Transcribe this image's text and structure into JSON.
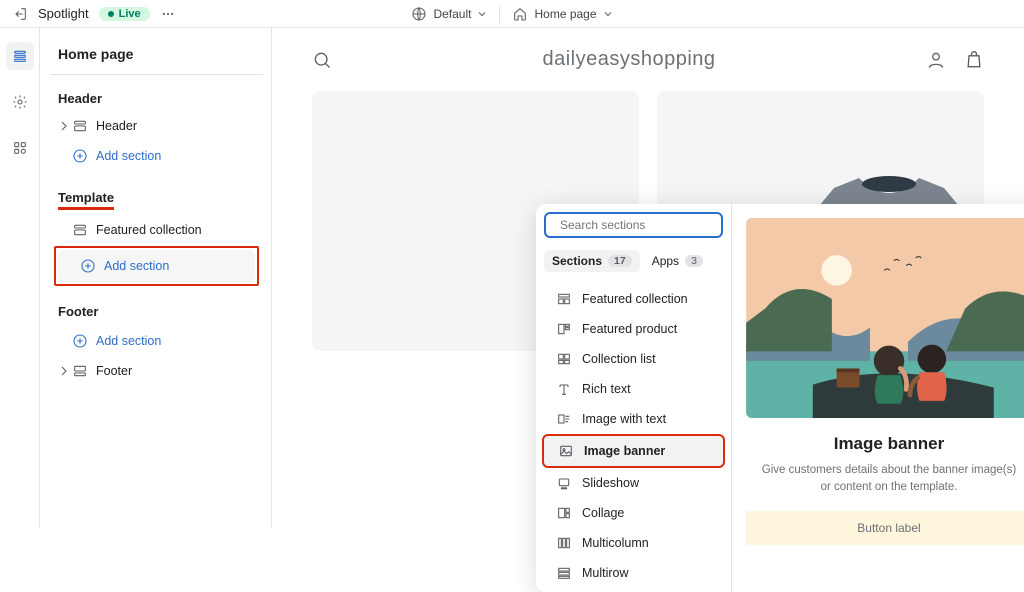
{
  "topbar": {
    "theme_name": "Spotlight",
    "status": "Live",
    "locale": "Default",
    "page_select": "Home page"
  },
  "sidebar": {
    "title": "Home page",
    "header": {
      "label": "Header",
      "item": "Header",
      "add": "Add section"
    },
    "template": {
      "label": "Template",
      "item": "Featured collection",
      "add": "Add section"
    },
    "footer": {
      "label": "Footer",
      "add": "Add section",
      "item": "Footer"
    }
  },
  "popup": {
    "search_placeholder": "Search sections",
    "tabs": {
      "sections_label": "Sections",
      "sections_count": "17",
      "apps_label": "Apps",
      "apps_count": "3"
    },
    "items": [
      "Featured collection",
      "Featured product",
      "Collection list",
      "Rich text",
      "Image with text",
      "Image banner",
      "Slideshow",
      "Collage",
      "Multicolumn",
      "Multirow"
    ],
    "preview": {
      "title": "Image banner",
      "desc": "Give customers details about the banner image(s) or content on the template.",
      "button": "Button label"
    }
  },
  "preview": {
    "store_name": "dailyeasyshopping"
  }
}
